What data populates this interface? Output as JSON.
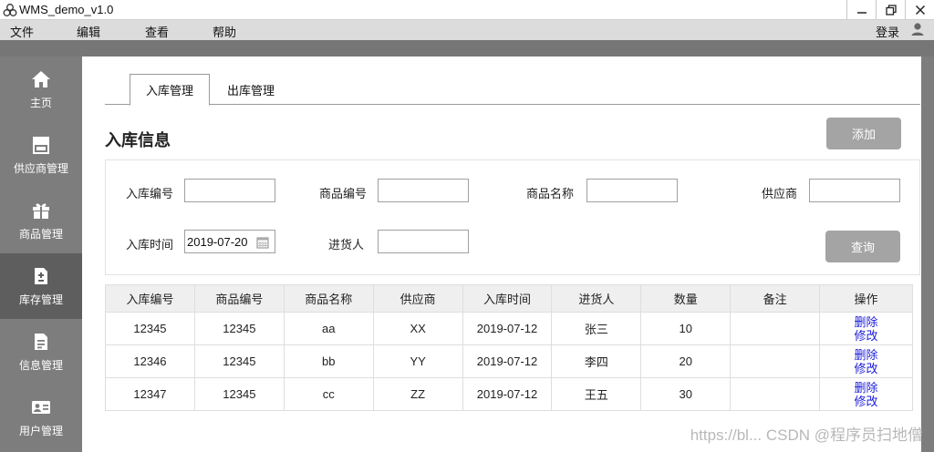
{
  "window": {
    "title": "WMS_demo_v1.0"
  },
  "menu": {
    "items": [
      "文件",
      "编辑",
      "查看",
      "帮助"
    ],
    "login": "登录"
  },
  "sidebar": {
    "items": [
      {
        "label": "主页",
        "icon": "home-icon"
      },
      {
        "label": "供应商管理",
        "icon": "store-icon"
      },
      {
        "label": "商品管理",
        "icon": "gift-icon"
      },
      {
        "label": "库存管理",
        "icon": "inventory-doc-icon"
      },
      {
        "label": "信息管理",
        "icon": "document-icon"
      },
      {
        "label": "用户管理",
        "icon": "id-card-icon"
      }
    ],
    "active": "库存管理"
  },
  "tabs": [
    "入库管理",
    "出库管理"
  ],
  "section": {
    "title": "入库信息",
    "add_label": "添加",
    "query_label": "查询"
  },
  "filters": {
    "inbound_no": {
      "label": "入库编号",
      "value": ""
    },
    "product_no": {
      "label": "商品编号",
      "value": ""
    },
    "product_name": {
      "label": "商品名称",
      "value": ""
    },
    "supplier": {
      "label": "供应商",
      "value": ""
    },
    "inbound_time": {
      "label": "入库时间",
      "value": "2019-07-20"
    },
    "purchaser": {
      "label": "进货人",
      "value": ""
    }
  },
  "table": {
    "headers": [
      "入库编号",
      "商品编号",
      "商品名称",
      "供应商",
      "入库时间",
      "进货人",
      "数量",
      "备注",
      "操作"
    ],
    "rows": [
      [
        "12345",
        "12345",
        "aa",
        "XX",
        "2019-07-12",
        "张三",
        "10",
        ""
      ],
      [
        "12346",
        "12345",
        "bb",
        "YY",
        "2019-07-12",
        "李四",
        "20",
        ""
      ],
      [
        "12347",
        "12345",
        "cc",
        "ZZ",
        "2019-07-12",
        "王五",
        "30",
        ""
      ]
    ],
    "actions": {
      "delete": "删除",
      "edit": "修改"
    }
  },
  "watermark": "https://bl... CSDN @程序员扫地僧",
  "colors": {
    "sidebar": "#7d7d7d",
    "sidebar_active": "#5e5e5e",
    "button": "#a4a4a4",
    "link": "#1a1adb"
  }
}
